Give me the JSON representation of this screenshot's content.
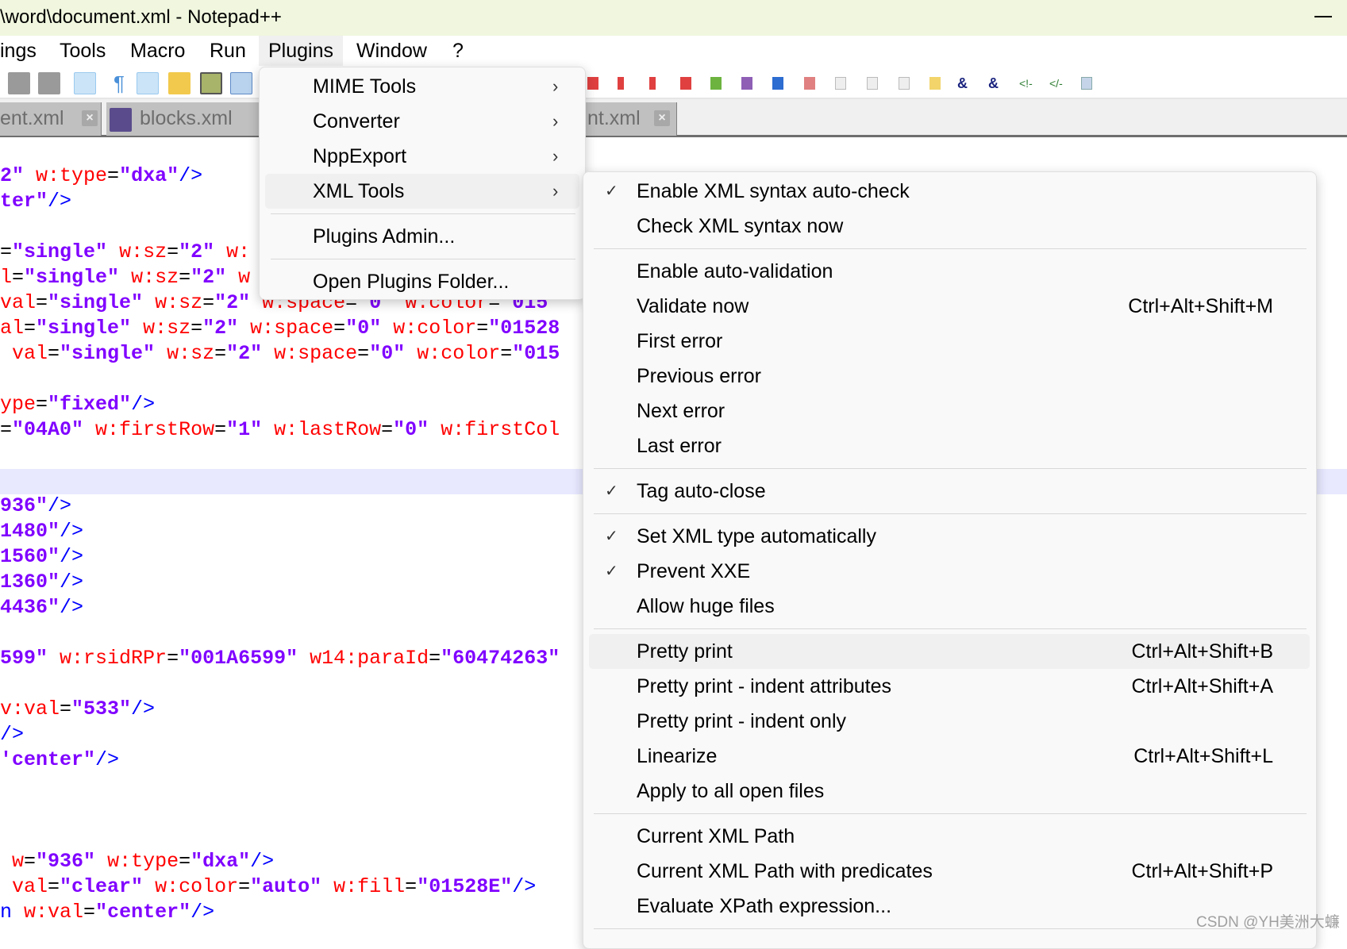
{
  "window": {
    "title": "\\word\\document.xml - Notepad++"
  },
  "menubar": [
    "ings",
    "Tools",
    "Macro",
    "Run",
    "Plugins",
    "Window",
    "?"
  ],
  "tabs": [
    {
      "label": "ent.xml"
    },
    {
      "label": "blocks.xml"
    },
    {
      "label": "nt.xml"
    }
  ],
  "colors": {
    "attribute": "#ff0000",
    "value": "#8000ff",
    "tag": "#0000ff",
    "current_line": "#e8e8ff",
    "title_bar": "#f0f7de"
  },
  "code_lines": [
    {
      "line": 0,
      "segs": [
        [
          "v",
          "2\""
        ],
        [
          "e",
          " "
        ],
        [
          "a",
          "w:type"
        ],
        [
          "e",
          "="
        ],
        [
          "v",
          "\"dxa\""
        ],
        [
          "t",
          "/>"
        ]
      ]
    },
    {
      "line": 1,
      "segs": [
        [
          "v",
          "ter\""
        ],
        [
          "t",
          "/>"
        ]
      ]
    },
    {
      "line": 3,
      "segs": [
        [
          "e",
          "="
        ],
        [
          "v",
          "\"single\""
        ],
        [
          "e",
          " "
        ],
        [
          "a",
          "w:sz"
        ],
        [
          "e",
          "="
        ],
        [
          "v",
          "\"2\""
        ],
        [
          "e",
          " "
        ],
        [
          "a",
          "w:"
        ]
      ]
    },
    {
      "line": 4,
      "segs": [
        [
          "a",
          "l"
        ],
        [
          "e",
          "="
        ],
        [
          "v",
          "\"single\""
        ],
        [
          "e",
          " "
        ],
        [
          "a",
          "w:sz"
        ],
        [
          "e",
          "="
        ],
        [
          "v",
          "\"2\""
        ],
        [
          "e",
          " "
        ],
        [
          "a",
          "w"
        ]
      ]
    },
    {
      "line": 5,
      "segs": [
        [
          "a",
          "val"
        ],
        [
          "e",
          "="
        ],
        [
          "v",
          "\"single\""
        ],
        [
          "e",
          " "
        ],
        [
          "a",
          "w:sz"
        ],
        [
          "e",
          "="
        ],
        [
          "v",
          "\"2\""
        ],
        [
          "e",
          " "
        ],
        [
          "a",
          "w:space"
        ],
        [
          "e",
          "="
        ],
        [
          "v",
          "\"0\""
        ],
        [
          "e",
          " "
        ],
        [
          "a",
          "w:color"
        ],
        [
          "e",
          "="
        ],
        [
          "v",
          "\"015"
        ]
      ]
    },
    {
      "line": 6,
      "segs": [
        [
          "a",
          "al"
        ],
        [
          "e",
          "="
        ],
        [
          "v",
          "\"single\""
        ],
        [
          "e",
          " "
        ],
        [
          "a",
          "w:sz"
        ],
        [
          "e",
          "="
        ],
        [
          "v",
          "\"2\""
        ],
        [
          "e",
          " "
        ],
        [
          "a",
          "w:space"
        ],
        [
          "e",
          "="
        ],
        [
          "v",
          "\"0\""
        ],
        [
          "e",
          " "
        ],
        [
          "a",
          "w:color"
        ],
        [
          "e",
          "="
        ],
        [
          "v",
          "\"01528"
        ]
      ]
    },
    {
      "line": 7,
      "segs": [
        [
          "a",
          " val"
        ],
        [
          "e",
          "="
        ],
        [
          "v",
          "\"single\""
        ],
        [
          "e",
          " "
        ],
        [
          "a",
          "w:sz"
        ],
        [
          "e",
          "="
        ],
        [
          "v",
          "\"2\""
        ],
        [
          "e",
          " "
        ],
        [
          "a",
          "w:space"
        ],
        [
          "e",
          "="
        ],
        [
          "v",
          "\"0\""
        ],
        [
          "e",
          " "
        ],
        [
          "a",
          "w:color"
        ],
        [
          "e",
          "="
        ],
        [
          "v",
          "\"015"
        ]
      ]
    },
    {
      "line": 9,
      "segs": [
        [
          "a",
          "ype"
        ],
        [
          "e",
          "="
        ],
        [
          "v",
          "\"fixed\""
        ],
        [
          "t",
          "/>"
        ]
      ]
    },
    {
      "line": 10,
      "segs": [
        [
          "e",
          "="
        ],
        [
          "v",
          "\"04A0\""
        ],
        [
          "e",
          " "
        ],
        [
          "a",
          "w:firstRow"
        ],
        [
          "e",
          "="
        ],
        [
          "v",
          "\"1\""
        ],
        [
          "e",
          " "
        ],
        [
          "a",
          "w:lastRow"
        ],
        [
          "e",
          "="
        ],
        [
          "v",
          "\"0\""
        ],
        [
          "e",
          " "
        ],
        [
          "a",
          "w:firstCol"
        ]
      ]
    },
    {
      "line": 13,
      "segs": [
        [
          "v",
          "936\""
        ],
        [
          "t",
          "/>"
        ]
      ]
    },
    {
      "line": 14,
      "segs": [
        [
          "v",
          "1480\""
        ],
        [
          "t",
          "/>"
        ]
      ]
    },
    {
      "line": 15,
      "segs": [
        [
          "v",
          "1560\""
        ],
        [
          "t",
          "/>"
        ]
      ]
    },
    {
      "line": 16,
      "segs": [
        [
          "v",
          "1360\""
        ],
        [
          "t",
          "/>"
        ]
      ]
    },
    {
      "line": 17,
      "segs": [
        [
          "v",
          "4436\""
        ],
        [
          "t",
          "/>"
        ]
      ]
    },
    {
      "line": 19,
      "segs": [
        [
          "v",
          "599\""
        ],
        [
          "e",
          " "
        ],
        [
          "a",
          "w:rsidRPr"
        ],
        [
          "e",
          "="
        ],
        [
          "v",
          "\"001A6599\""
        ],
        [
          "e",
          " "
        ],
        [
          "a",
          "w14:paraId"
        ],
        [
          "e",
          "="
        ],
        [
          "v",
          "\"60474263\""
        ]
      ]
    },
    {
      "line": 21,
      "segs": [
        [
          "a",
          "v:val"
        ],
        [
          "e",
          "="
        ],
        [
          "v",
          "\"533\""
        ],
        [
          "t",
          "/>"
        ]
      ]
    },
    {
      "line": 22,
      "segs": [
        [
          "t",
          "/>"
        ]
      ]
    },
    {
      "line": 23,
      "segs": [
        [
          "v",
          "'center\""
        ],
        [
          "t",
          "/>"
        ]
      ]
    },
    {
      "line": 27,
      "segs": [
        [
          "a",
          " w"
        ],
        [
          "e",
          "="
        ],
        [
          "v",
          "\"936\""
        ],
        [
          "e",
          " "
        ],
        [
          "a",
          "w:type"
        ],
        [
          "e",
          "="
        ],
        [
          "v",
          "\"dxa\""
        ],
        [
          "t",
          "/>"
        ]
      ]
    },
    {
      "line": 28,
      "segs": [
        [
          "a",
          " val"
        ],
        [
          "e",
          "="
        ],
        [
          "v",
          "\"clear\""
        ],
        [
          "e",
          " "
        ],
        [
          "a",
          "w:color"
        ],
        [
          "e",
          "="
        ],
        [
          "v",
          "\"auto\""
        ],
        [
          "e",
          " "
        ],
        [
          "a",
          "w:fill"
        ],
        [
          "e",
          "="
        ],
        [
          "v",
          "\"01528E\""
        ],
        [
          "t",
          "/>"
        ]
      ]
    },
    {
      "line": 29,
      "segs": [
        [
          "t",
          "n"
        ],
        [
          "e",
          " "
        ],
        [
          "a",
          "w:val"
        ],
        [
          "e",
          "="
        ],
        [
          "v",
          "\"center\""
        ],
        [
          "t",
          "/>"
        ]
      ]
    }
  ],
  "plugins_menu": {
    "items": [
      {
        "label": "MIME Tools",
        "submenu": true
      },
      {
        "label": "Converter",
        "submenu": true
      },
      {
        "label": "NppExport",
        "submenu": true
      },
      {
        "label": "XML Tools",
        "submenu": true,
        "highlighted": true
      },
      {
        "separator": true
      },
      {
        "label": "Plugins Admin..."
      },
      {
        "separator": true
      },
      {
        "label": "Open Plugins Folder..."
      }
    ]
  },
  "xml_tools_menu": {
    "items": [
      {
        "label": "Enable XML syntax auto-check",
        "checked": true
      },
      {
        "label": "Check XML syntax now"
      },
      {
        "separator": true
      },
      {
        "label": "Enable auto-validation"
      },
      {
        "label": "Validate now",
        "shortcut": "Ctrl+Alt+Shift+M"
      },
      {
        "label": "First error"
      },
      {
        "label": "Previous error"
      },
      {
        "label": "Next error"
      },
      {
        "label": "Last error"
      },
      {
        "separator": true
      },
      {
        "label": "Tag auto-close",
        "checked": true
      },
      {
        "separator": true
      },
      {
        "label": "Set XML type automatically",
        "checked": true
      },
      {
        "label": "Prevent XXE",
        "checked": true
      },
      {
        "label": "Allow huge files"
      },
      {
        "separator": true
      },
      {
        "label": "Pretty print",
        "shortcut": "Ctrl+Alt+Shift+B",
        "highlighted": true
      },
      {
        "label": "Pretty print - indent attributes",
        "shortcut": "Ctrl+Alt+Shift+A"
      },
      {
        "label": "Pretty print - indent only"
      },
      {
        "label": "Linearize",
        "shortcut": "Ctrl+Alt+Shift+L"
      },
      {
        "label": "Apply to all open files"
      },
      {
        "separator": true
      },
      {
        "label": "Current XML Path"
      },
      {
        "label": "Current XML Path with predicates",
        "shortcut": "Ctrl+Alt+Shift+P"
      },
      {
        "label": "Evaluate XPath expression..."
      },
      {
        "separator": true
      }
    ]
  },
  "watermark": "CSDN @YH美洲大蠊"
}
